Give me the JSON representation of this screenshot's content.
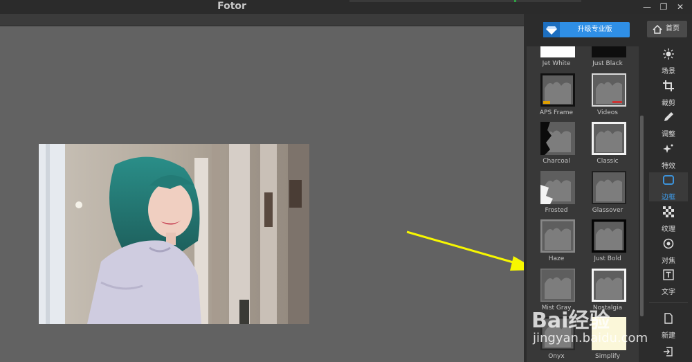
{
  "window": {
    "title": "Fotor"
  },
  "header": {
    "upgrade_label": "升级专业版",
    "home_label": "首页"
  },
  "frames": [
    {
      "label": "Jet White",
      "style": "white"
    },
    {
      "label": "Just Black",
      "style": "black"
    },
    {
      "label": "APS Frame",
      "style": "aps"
    },
    {
      "label": "Videos",
      "style": "videos"
    },
    {
      "label": "Charcoal",
      "style": "charcoal"
    },
    {
      "label": "Classic",
      "style": "classic"
    },
    {
      "label": "Frosted",
      "style": "frosted"
    },
    {
      "label": "Glassover",
      "style": "glassover"
    },
    {
      "label": "Haze",
      "style": "haze"
    },
    {
      "label": "Just Bold",
      "style": "bold"
    },
    {
      "label": "Mist Gray",
      "style": "mist"
    },
    {
      "label": "Nostalgia",
      "style": "nostalgia"
    },
    {
      "label": "Onyx",
      "style": "onyx"
    },
    {
      "label": "Simplify",
      "style": "simplify"
    }
  ],
  "tools": [
    {
      "label": "场景",
      "icon": "sun-icon",
      "active": false
    },
    {
      "label": "裁剪",
      "icon": "crop-icon",
      "active": false
    },
    {
      "label": "调整",
      "icon": "pencil-icon",
      "active": false
    },
    {
      "label": "特效",
      "icon": "sparkle-icon",
      "active": false
    },
    {
      "label": "边框",
      "icon": "frame-icon",
      "active": true
    },
    {
      "label": "纹理",
      "icon": "texture-icon",
      "active": false
    },
    {
      "label": "对焦",
      "icon": "focus-icon",
      "active": false
    },
    {
      "label": "文字",
      "icon": "text-icon",
      "active": false
    }
  ],
  "bottom_tools": [
    {
      "label": "新建",
      "icon": "new-file-icon"
    }
  ],
  "watermark": {
    "line1": "Bai经验",
    "line2": "jingyan.baidu.com"
  },
  "colors": {
    "accent": "#2f8fe6",
    "arrow": "#f7f700",
    "panel": "#2c2c2c",
    "canvas": "#626262"
  }
}
